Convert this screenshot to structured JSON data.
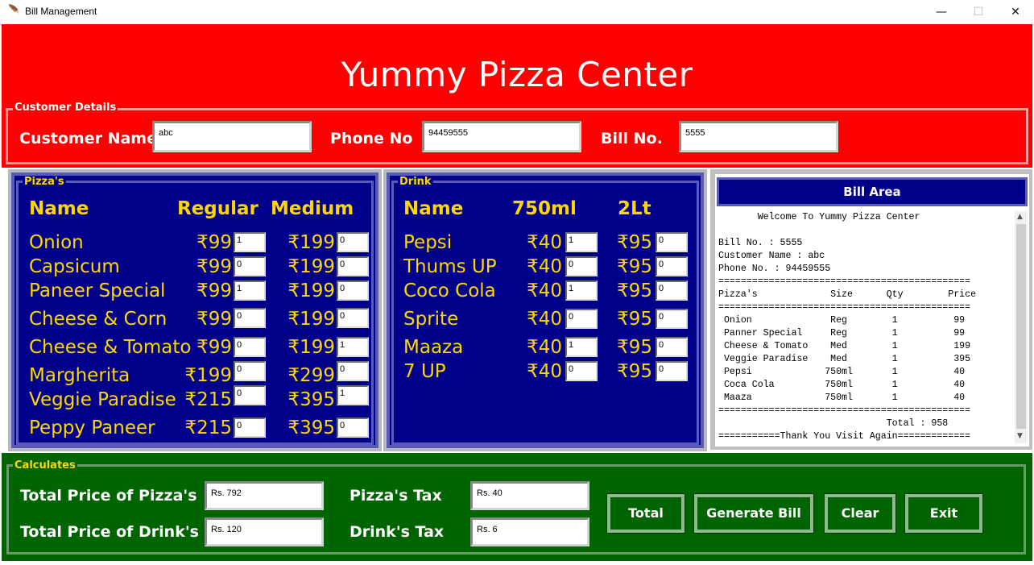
{
  "window": {
    "title": "Bill Management",
    "minimize": "—",
    "maximize": "☐",
    "close": "✕"
  },
  "header": {
    "title": "Yummy Pizza Center",
    "bg": "#ff0000"
  },
  "customer": {
    "legend": "Customer Details",
    "name_label": "Customer Name",
    "name_value": "abc",
    "phone_label": "Phone No",
    "phone_value": "94459555",
    "bill_label": "Bill No.",
    "bill_value": "5555"
  },
  "pizzas": {
    "legend": "Pizza's",
    "headers": [
      "Name",
      "Regular",
      "Medium"
    ],
    "items": [
      {
        "name": "Onion",
        "regular": "₹99",
        "reg_qty": "1",
        "medium": "₹199",
        "med_qty": "0"
      },
      {
        "name": "Capsicum",
        "regular": "₹99",
        "reg_qty": "0",
        "medium": "₹199",
        "med_qty": "0"
      },
      {
        "name": "Paneer Special",
        "regular": "₹99",
        "reg_qty": "1",
        "medium": "₹199",
        "med_qty": "0"
      },
      {
        "name": "Cheese & Corn",
        "regular": "₹99",
        "reg_qty": "0",
        "medium": "₹199",
        "med_qty": "0"
      },
      {
        "name": "Cheese & Tomato",
        "regular": "₹99",
        "reg_qty": "0",
        "medium": "₹199",
        "med_qty": "1"
      },
      {
        "name": "Margherita",
        "regular": "₹199",
        "reg_qty": "0",
        "medium": "₹299",
        "med_qty": "0"
      },
      {
        "name": "Veggie Paradise",
        "regular": "₹215",
        "reg_qty": "0",
        "medium": "₹395",
        "med_qty": "1"
      },
      {
        "name": "Peppy Paneer",
        "regular": "₹215",
        "reg_qty": "0",
        "medium": "₹395",
        "med_qty": "0"
      }
    ]
  },
  "drinks": {
    "legend": "Drink",
    "headers": [
      "Name",
      "750ml",
      "2Lt"
    ],
    "items": [
      {
        "name": "Pepsi",
        "small": "₹40",
        "small_qty": "1",
        "large": "₹95",
        "large_qty": "0"
      },
      {
        "name": "Thums UP",
        "small": "₹40",
        "small_qty": "0",
        "large": "₹95",
        "large_qty": "0"
      },
      {
        "name": "Coco Cola",
        "small": "₹40",
        "small_qty": "1",
        "large": "₹95",
        "large_qty": "0"
      },
      {
        "name": "Sprite",
        "small": "₹40",
        "small_qty": "0",
        "large": "₹95",
        "large_qty": "0"
      },
      {
        "name": "Maaza",
        "small": "₹40",
        "small_qty": "1",
        "large": "₹95",
        "large_qty": "0"
      },
      {
        "name": "7 UP",
        "small": "₹40",
        "small_qty": "0",
        "large": "₹95",
        "large_qty": "0"
      }
    ]
  },
  "bill": {
    "title": "Bill Area",
    "lines": [
      "       Welcome To Yummy Pizza Center",
      "",
      "Bill No. : 5555",
      "Customer Name : abc",
      "Phone No. : 94459555",
      "=============================================",
      "Pizza's             Size      Qty        Price",
      "=============================================",
      " Onion              Reg        1          99",
      " Panner Special     Reg        1          99",
      " Cheese & Tomato    Med        1          199",
      " Veggie Paradise    Med        1          395",
      " Pepsi             750ml       1          40",
      " Coca Cola         750ml       1          40",
      " Maaza             750ml       1          40",
      "=============================================",
      "                              Total : 958",
      "===========Thank You Visit Again============="
    ]
  },
  "calc": {
    "legend": "Calculates",
    "pizza_total_label": "Total Price of Pizza's",
    "pizza_total_value": "Rs. 792",
    "drink_total_label": "Total Price of Drink's",
    "drink_total_value": "Rs. 120",
    "pizza_tax_label": "Pizza's Tax",
    "pizza_tax_value": "Rs. 40",
    "drink_tax_label": "Drink's Tax",
    "drink_tax_value": "Rs. 6",
    "buttons": {
      "total": "Total",
      "generate": "Generate Bill",
      "clear": "Clear",
      "exit": "Exit"
    }
  }
}
